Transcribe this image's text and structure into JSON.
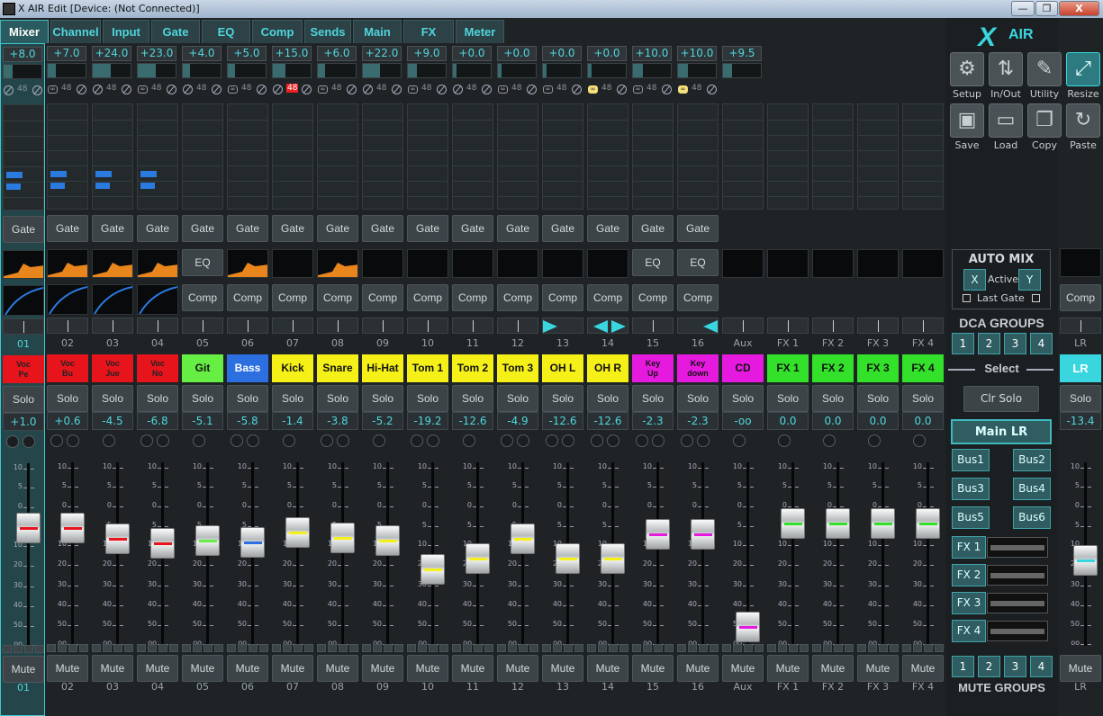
{
  "window": {
    "title": "X AIR Edit [Device: (Not Connected)]",
    "min": "—",
    "max": "❐",
    "close": "X"
  },
  "tabs": [
    "Mixer",
    "Channel",
    "Input",
    "Gate",
    "EQ",
    "Comp",
    "Sends",
    "Main",
    "FX",
    "Meter"
  ],
  "labels": {
    "gate": "Gate",
    "eq": "EQ",
    "comp": "Comp",
    "solo": "Solo",
    "mute": "Mute",
    "ph": "48"
  },
  "channels": [
    {
      "num": "01",
      "gain": "+8.0",
      "gainpct": 0.24,
      "name": [
        "Voc",
        "Pe"
      ],
      "color": "#e8141c",
      "level": "+1.0",
      "fader": 0.68,
      "cap": "#e8141c",
      "dyn": "gate",
      "eq": "curve",
      "comp": "curve",
      "stereo": false,
      "sel": true,
      "blue": true
    },
    {
      "num": "02",
      "gain": "+7.0",
      "gainpct": 0.22,
      "name": [
        "Voc",
        "Bu"
      ],
      "color": "#e8141c",
      "level": "+0.6",
      "fader": 0.67,
      "cap": "#e8141c",
      "dyn": "gate",
      "eq": "curve",
      "comp": "curve",
      "stereo": true,
      "blue": true
    },
    {
      "num": "03",
      "gain": "+24.0",
      "gainpct": 0.48,
      "name": [
        "Voc",
        "Jue"
      ],
      "color": "#e8141c",
      "level": "-4.5",
      "fader": 0.6,
      "cap": "#e8141c",
      "dyn": "gate",
      "eq": "curve",
      "comp": "curve",
      "stereo": false,
      "blue": true
    },
    {
      "num": "04",
      "gain": "+23.0",
      "gainpct": 0.47,
      "name": [
        "Voc",
        "No"
      ],
      "color": "#e8141c",
      "level": "-6.8",
      "fader": 0.57,
      "cap": "#e8141c",
      "dyn": "gate",
      "eq": "curve",
      "comp": "curve",
      "stereo": true,
      "blue": true
    },
    {
      "num": "05",
      "gain": "+4.0",
      "gainpct": 0.18,
      "name": [
        "Git"
      ],
      "color": "#66ee44",
      "level": "-5.1",
      "fader": 0.59,
      "cap": "#66ee44",
      "dyn": "gate",
      "eq": "btn",
      "comp": "btn",
      "stereo": false
    },
    {
      "num": "06",
      "gain": "+5.0",
      "gainpct": 0.19,
      "name": [
        "Bass"
      ],
      "color": "#2b6fe0",
      "level": "-5.8",
      "fader": 0.58,
      "cap": "#2b6fe0",
      "dyn": "gate",
      "eq": "curve",
      "comp": "btn",
      "stereo": true
    },
    {
      "num": "07",
      "gain": "+15.0",
      "gainpct": 0.33,
      "name": [
        "Kick"
      ],
      "color": "#f5f018",
      "level": "-1.4",
      "fader": 0.64,
      "cap": "#f5f018",
      "dyn": "gate",
      "eq": "black",
      "comp": "btn",
      "stereo": false,
      "redph": true
    },
    {
      "num": "08",
      "gain": "+6.0",
      "gainpct": 0.2,
      "name": [
        "Snare"
      ],
      "color": "#f5f018",
      "level": "-3.8",
      "fader": 0.61,
      "cap": "#f5f018",
      "dyn": "gate",
      "eq": "curve",
      "comp": "btn",
      "stereo": true
    },
    {
      "num": "09",
      "gain": "+22.0",
      "gainpct": 0.45,
      "name": [
        "Hi-Hat"
      ],
      "color": "#f5f018",
      "level": "-5.2",
      "fader": 0.59,
      "cap": "#f5f018",
      "dyn": "gate",
      "eq": "black",
      "comp": "btn",
      "stereo": false
    },
    {
      "num": "10",
      "gain": "+9.0",
      "gainpct": 0.24,
      "name": [
        "Tom 1"
      ],
      "color": "#f5f018",
      "level": "-19.2",
      "fader": 0.4,
      "cap": "#f5f018",
      "dyn": "gate",
      "eq": "black",
      "comp": "btn",
      "stereo": true
    },
    {
      "num": "11",
      "gain": "+0.0",
      "gainpct": 0.1,
      "name": [
        "Tom 2"
      ],
      "color": "#f5f018",
      "level": "-12.6",
      "fader": 0.47,
      "cap": "#f5f018",
      "dyn": "gate",
      "eq": "black",
      "comp": "btn",
      "stereo": false
    },
    {
      "num": "12",
      "gain": "+0.0",
      "gainpct": 0.1,
      "name": [
        "Tom 3"
      ],
      "color": "#f5f018",
      "level": "-4.9",
      "fader": 0.6,
      "cap": "#f5f018",
      "dyn": "gate",
      "eq": "black",
      "comp": "btn",
      "stereo": true
    },
    {
      "num": "13",
      "gain": "+0.0",
      "gainpct": 0.1,
      "name": [
        "OH L"
      ],
      "color": "#f5f018",
      "level": "-12.6",
      "fader": 0.47,
      "cap": "#f5f018",
      "dyn": "gate",
      "eq": "black",
      "comp": "btn",
      "stereo": false,
      "link": true,
      "pan": "r"
    },
    {
      "num": "14",
      "gain": "+0.0",
      "gainpct": 0.1,
      "name": [
        "OH R"
      ],
      "color": "#f5f018",
      "level": "-12.6",
      "fader": 0.47,
      "cap": "#f5f018",
      "dyn": "gate",
      "eq": "black",
      "comp": "btn",
      "stereo": true,
      "link": true,
      "pan": "lr"
    },
    {
      "num": "15",
      "gain": "+10.0",
      "gainpct": 0.26,
      "name": [
        "Key",
        "Up"
      ],
      "color": "#e61adf",
      "level": "-2.3",
      "fader": 0.63,
      "cap": "#e61adf",
      "dyn": "gate",
      "eq": "btn",
      "comp": "btn",
      "stereo": false,
      "link": true,
      "small": true
    },
    {
      "num": "16",
      "gain": "+10.0",
      "gainpct": 0.26,
      "name": [
        "Key",
        "down"
      ],
      "color": "#e61adf",
      "level": "-2.3",
      "fader": 0.63,
      "cap": "#e61adf",
      "dyn": "gate",
      "eq": "btn",
      "comp": "btn",
      "stereo": true,
      "link": true,
      "small": true,
      "pan": "l"
    },
    {
      "num": "Aux",
      "gain": "+9.5",
      "gainpct": 0.24,
      "name": [
        "CD"
      ],
      "color": "#e61adf",
      "level": "-oo",
      "fader": 0.02,
      "cap": "#e61adf",
      "dyn": "none",
      "eq": "black",
      "comp": "none",
      "stereo": false
    },
    {
      "num": "FX 1",
      "name": [
        "FX 1"
      ],
      "color": "#33e02a",
      "level": "0.0",
      "fader": 0.7,
      "cap": "#33e02a",
      "dyn": "none",
      "eq": "black",
      "comp": "none",
      "fx": true
    },
    {
      "num": "FX 2",
      "name": [
        "FX 2"
      ],
      "color": "#33e02a",
      "level": "0.0",
      "fader": 0.7,
      "cap": "#33e02a",
      "dyn": "none",
      "eq": "black",
      "comp": "none",
      "fx": true
    },
    {
      "num": "FX 3",
      "name": [
        "FX 3"
      ],
      "color": "#33e02a",
      "level": "0.0",
      "fader": 0.7,
      "cap": "#33e02a",
      "dyn": "none",
      "eq": "black",
      "comp": "none",
      "fx": true
    },
    {
      "num": "FX 4",
      "name": [
        "FX 4"
      ],
      "color": "#33e02a",
      "level": "0.0",
      "fader": 0.7,
      "cap": "#33e02a",
      "dyn": "none",
      "eq": "black",
      "comp": "none",
      "fx": true
    }
  ],
  "scale": [
    "10",
    "5",
    "0",
    "5",
    "10",
    "20",
    "30",
    "40",
    "50",
    "oo"
  ],
  "right": {
    "logo_x": "X",
    "logo_air": "AIR",
    "tools": [
      {
        "label": "Setup",
        "icon": "gear-icon",
        "glyph": "⚙"
      },
      {
        "label": "In/Out",
        "icon": "arrows-icon",
        "glyph": "⇅"
      },
      {
        "label": "Utility",
        "icon": "wrench-icon",
        "glyph": "✎"
      },
      {
        "label": "Resize",
        "icon": "resize-icon",
        "glyph": "⤢"
      },
      {
        "label": "Save",
        "icon": "floppy-icon",
        "glyph": "▣"
      },
      {
        "label": "Load",
        "icon": "folder-icon",
        "glyph": "▭"
      },
      {
        "label": "Copy",
        "icon": "copy-icon",
        "glyph": "❐"
      },
      {
        "label": "Paste",
        "icon": "paste-icon",
        "glyph": "↻"
      }
    ],
    "automix": {
      "title": "AUTO MIX",
      "x": "X",
      "active": "Active",
      "y": "Y",
      "lastgate": "Last Gate"
    },
    "dca": "DCA GROUPS",
    "groups": [
      "1",
      "2",
      "3",
      "4"
    ],
    "select": "Select",
    "clrsolo": "Clr Solo",
    "mainlr": "Main LR",
    "bus": [
      "Bus1",
      "Bus2",
      "Bus3",
      "Bus4",
      "Bus5",
      "Bus6"
    ],
    "fx": [
      "FX 1",
      "FX 2",
      "FX 3",
      "FX 4"
    ],
    "mutegroups": "MUTE GROUPS"
  },
  "lr": {
    "name": "LR",
    "level": "-13.4",
    "fader": 0.46,
    "num": "LR",
    "comp": "Comp",
    "solo": "Solo",
    "mute": "Mute"
  }
}
